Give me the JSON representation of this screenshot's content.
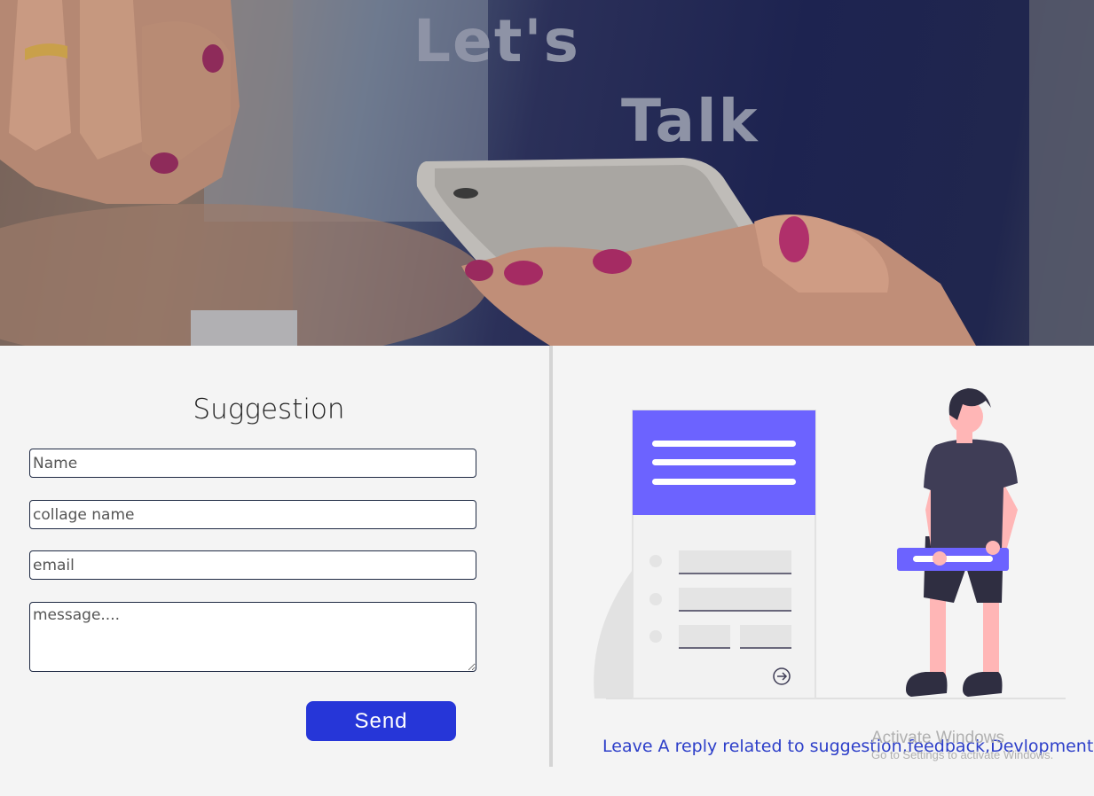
{
  "hero": {
    "title_line1": "Let's",
    "title_line2": "Talk"
  },
  "form": {
    "title": "Suggestion",
    "name_placeholder": "Name",
    "college_placeholder": "collage name",
    "email_placeholder": "email",
    "message_placeholder": "message....",
    "send_label": "Send"
  },
  "illustration": {
    "caption": "Leave A reply related to suggestion,feedback,Devlopment.",
    "accent_color": "#6c63ff"
  },
  "watermark": {
    "line1": "Activate Windows",
    "line2": "Go to Settings to activate Windows."
  },
  "colors": {
    "send_button": "#2636d8",
    "caption": "#2c3ec9",
    "field_border": "#1f2a44"
  }
}
